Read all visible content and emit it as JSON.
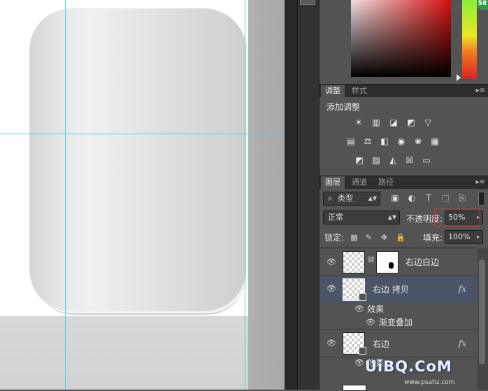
{
  "colors": {
    "guide": "#3fd9e8",
    "panel_bg": "#535353",
    "selected_layer": "#4c5468",
    "highlight_box": "#e03030"
  },
  "color_picker": {
    "badge": "58"
  },
  "adjustments": {
    "tabs": [
      {
        "label": "调整",
        "active": true
      },
      {
        "label": "样式",
        "active": false
      }
    ],
    "heading": "添加调整",
    "row1_icons": [
      "brightness-icon",
      "levels-icon",
      "curves-icon",
      "exposure-icon",
      "vibrance-icon"
    ],
    "row2_icons": [
      "hue-saturation-icon",
      "color-balance-icon",
      "black-white-icon",
      "photo-filter-icon",
      "channel-mixer-icon",
      "color-lookup-icon"
    ],
    "row3_icons": [
      "invert-icon",
      "posterize-icon",
      "threshold-icon",
      "selective-color-icon",
      "gradient-map-icon"
    ]
  },
  "layers": {
    "tabs": [
      {
        "label": "图层",
        "active": true
      },
      {
        "label": "通道",
        "active": false
      },
      {
        "label": "路径",
        "active": false
      }
    ],
    "filter_type": "类型",
    "blend_mode": "正常",
    "opacity_label": "不透明度:",
    "opacity_value": "50%",
    "lock_label": "锁定:",
    "fill_label": "填充:",
    "fill_value": "100%",
    "items": [
      {
        "name": "右边白边"
      },
      {
        "name": "右边 拷贝",
        "fx": "fx",
        "effects_label": "效果",
        "effect": "渐变叠加"
      },
      {
        "name": "右边",
        "fx": "fx",
        "effects_label": "效果"
      }
    ]
  },
  "watermark": "UiBQ.CoM",
  "watermark_url": "www.psahz.com"
}
